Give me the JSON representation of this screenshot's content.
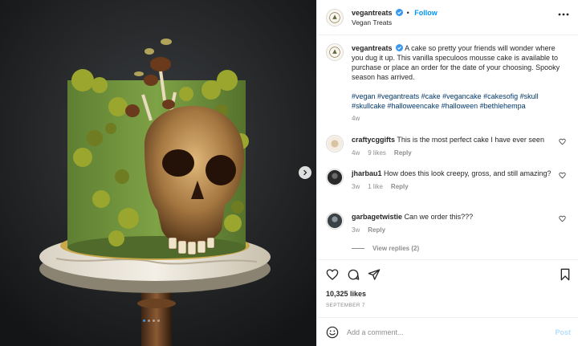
{
  "account": {
    "username": "vegantreats",
    "display_name": "Vegan Treats",
    "follow_label": "Follow",
    "verified": true,
    "dot": "•"
  },
  "media": {
    "slides_total": 4,
    "current_slide": 1,
    "accent": "#3897f0"
  },
  "caption": {
    "username": "vegantreats",
    "text": "A cake so pretty your friends will wonder where you dug it up. This vanilla speculoos mousse cake is available to purchase or place an order for the date of your choosing. Spooky season has arrived.",
    "hashtags": "#vegan #vegantreats #cake #vegancake #cakesofig #skull #skullcake #halloweencake #halloween #bethlehempa",
    "time": "4w"
  },
  "comments": [
    {
      "username": "craftycggifts",
      "text": "This is the most perfect cake I have ever seen",
      "time": "4w",
      "likes": "9 likes",
      "reply": "Reply"
    },
    {
      "username": "jharbau1",
      "text": "How does this look creepy, gross, and still amazing?",
      "time": "3w",
      "likes": "1 like",
      "reply": "Reply"
    },
    {
      "username": "garbagetwistie",
      "text": "Can we order this???",
      "time": "3w",
      "reply": "Reply"
    }
  ],
  "view_replies": "View replies (2)",
  "likes_count": "10,325 likes",
  "date": "SEPTEMBER 7",
  "composer": {
    "placeholder": "Add a comment...",
    "post_label": "Post"
  },
  "icons": {
    "more": "more-horizontal-icon",
    "heart": "heart-icon",
    "comment": "comment-icon",
    "share": "share-icon",
    "bookmark": "bookmark-icon",
    "emoji": "emoji-icon",
    "next": "chevron-right-icon",
    "verified": "verified-badge-icon"
  },
  "colors": {
    "link": "#0095f6",
    "hashtag": "#00376b",
    "muted": "#8e8e8e",
    "post_disabled": "#b2dffc"
  }
}
